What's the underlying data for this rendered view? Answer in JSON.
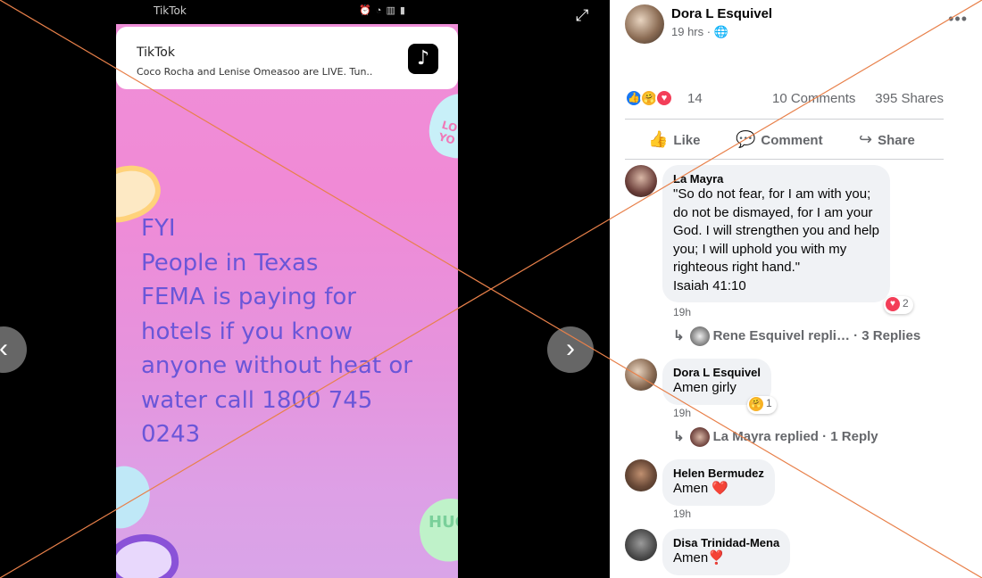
{
  "viewer": {
    "status_app": "TikTok",
    "status_icons": "⏰ ◔ ▥ ▮",
    "notification": {
      "app_name": "TikTok",
      "message": "Coco Rocha and Lenise Omeasoo are LIVE. Tun..",
      "logo_glyph": "♪"
    },
    "heart_text_1": "LO YO",
    "heart_text_2": "HUG",
    "overlay_lines": [
      "FYI",
      "People in Texas",
      "FEMA is paying for",
      "hotels if you know",
      "anyone without heat or",
      "water call 1800 745",
      "0243"
    ],
    "prev_glyph": "‹",
    "next_glyph": "›",
    "expand_glyph": "⤢"
  },
  "post": {
    "author": "Dora L Esquivel",
    "time": "19 hrs · 🌐",
    "more_glyph": "•••",
    "reactions_count": "14",
    "comments_count": "10 Comments",
    "shares_count": "395 Shares",
    "like_label": "Like",
    "comment_label": "Comment",
    "share_label": "Share",
    "like_icon": "👍",
    "comment_icon": "💬",
    "share_icon": "↪"
  },
  "comments": [
    {
      "name": "La Mayra",
      "lines": [
        "\"So do not fear, for I am with you;",
        "do not be dismayed, for I am your",
        "God. I will strengthen you and help",
        "you; I will uphold you with my",
        "righteous right hand.\"",
        "Isaiah 41:10"
      ],
      "time": "19h",
      "reaction_count": "2",
      "replies": "Rene Esquivel repli… · 3 Replies"
    },
    {
      "name": "Dora L Esquivel",
      "lines": [
        "Amen girly"
      ],
      "time": "19h",
      "reaction_count": "1",
      "replies": "La Mayra replied · 1 Reply"
    },
    {
      "name": "Helen Bermudez",
      "lines": [
        "Amen ❤️"
      ],
      "time": "19h"
    },
    {
      "name": "Disa Trinidad-Mena",
      "lines": [
        "Amen❣️"
      ]
    }
  ],
  "colors": {
    "overlay_text": "#6a56d8",
    "like_blue": "#1877f2",
    "love_red": "#f33e58",
    "care_yellow": "#f7b125",
    "diagonal_lines": "#e8804a"
  }
}
